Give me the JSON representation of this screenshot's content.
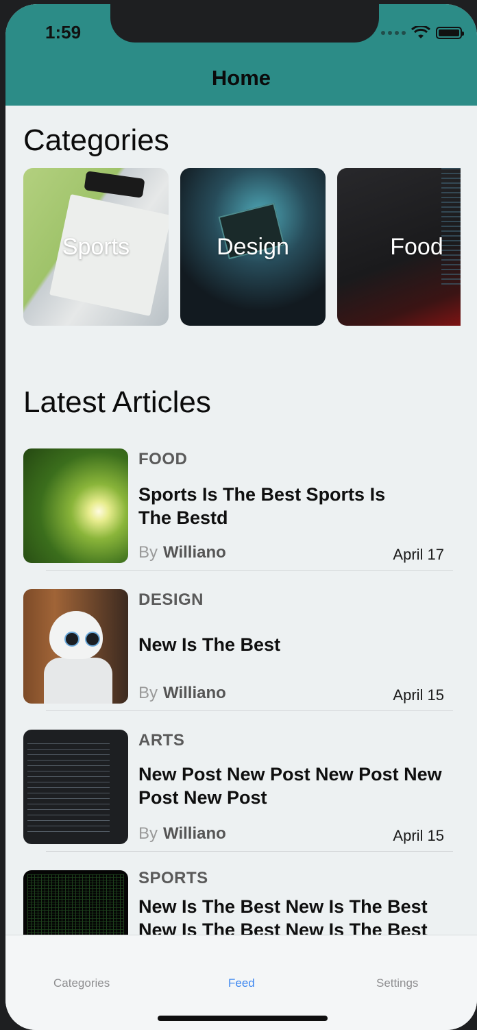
{
  "status_bar": {
    "time": "1:59"
  },
  "header": {
    "title": "Home"
  },
  "categories_section": {
    "title": "Categories",
    "items": [
      {
        "label": "Sports"
      },
      {
        "label": "Design"
      },
      {
        "label": "Food"
      }
    ]
  },
  "articles_section": {
    "title": "Latest Articles",
    "items": [
      {
        "category": "FOOD",
        "title_line1": "Sports Is The Best Sports Is",
        "title_line2": "The Bestd",
        "by": "By",
        "author": "Williano",
        "date": "April 17",
        "thumb": "forest-image"
      },
      {
        "category": "DESIGN",
        "title_line1": "New Is The Best",
        "title_line2": "",
        "by": "By",
        "author": "Williano",
        "date": "April 15",
        "thumb": "robot-image"
      },
      {
        "category": "ARTS",
        "title_line1": "New Post New Post New Post New",
        "title_line2": "Post New Post",
        "by": "By",
        "author": "Williano",
        "date": "April 15",
        "thumb": "code-image"
      },
      {
        "category": "SPORTS",
        "title_line1": "New Is The Best New Is The Best",
        "title_line2": "New Is The Best New Is The Best",
        "by": "",
        "author": "",
        "date": "",
        "thumb": "matrix-image"
      }
    ]
  },
  "tab_bar": {
    "tabs": [
      {
        "label": "Categories",
        "active": false
      },
      {
        "label": "Feed",
        "active": true
      },
      {
        "label": "Settings",
        "active": false
      }
    ]
  },
  "colors": {
    "header": "#2c8c87",
    "background": "#edf1f2",
    "active_tab": "#3d87f0"
  }
}
